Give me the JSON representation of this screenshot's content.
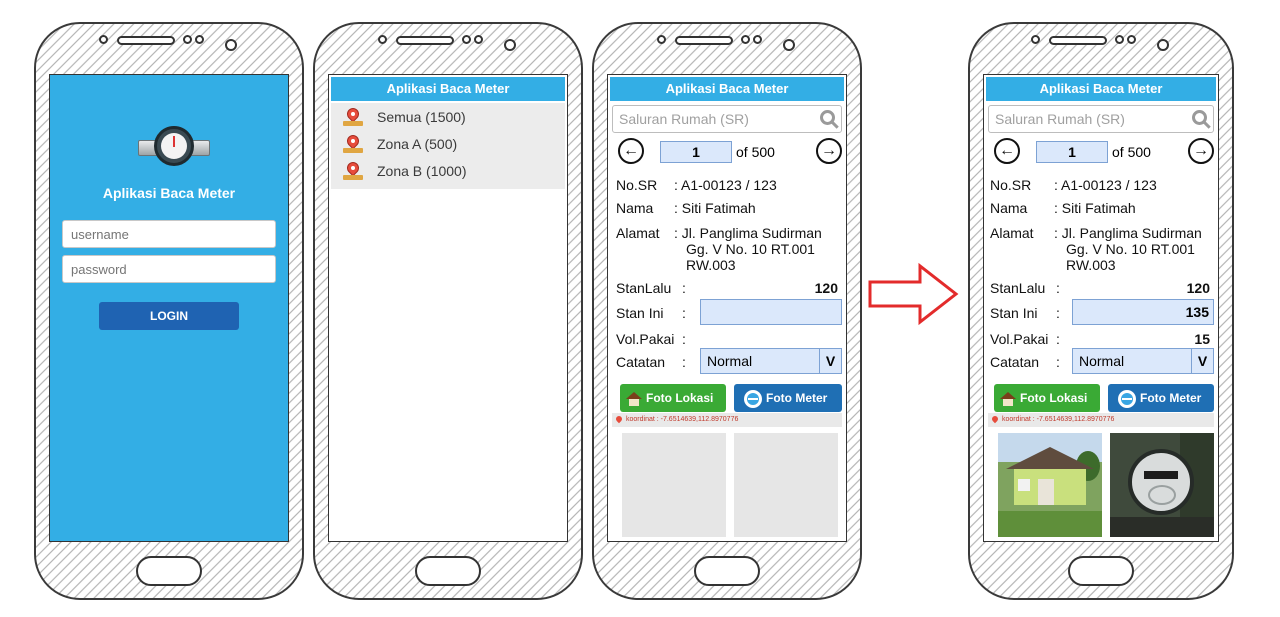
{
  "app_title": "Aplikasi Baca Meter",
  "login": {
    "username_placeholder": "username",
    "password_placeholder": "password",
    "login_label": "LOGIN"
  },
  "zones": [
    {
      "label": "Semua (1500)"
    },
    {
      "label": "Zona A (500)"
    },
    {
      "label": "Zona B (1000)"
    }
  ],
  "detail": {
    "search_placeholder": "Saluran Rumah (SR)",
    "page_current": "1",
    "page_total": "of 500",
    "prev_icon": "←",
    "next_icon": "→",
    "label_nosr": "No.SR",
    "label_nama": "Nama",
    "label_alamat": "Alamat",
    "label_stanlalu": "StanLalu",
    "label_stanini": "Stan Ini",
    "label_volpakai": "Vol.Pakai",
    "label_catatan": "Catatan",
    "colon": ":",
    "nosr": ": A1-00123 / 123",
    "nama": ": Siti Fatimah",
    "alamat_1": ": Jl. Panglima Sudirman",
    "alamat_2": "Gg. V No. 10 RT.001",
    "alamat_3": "RW.003",
    "stanlalu": "120",
    "catatan": "Normal",
    "catatan_arrow": "V",
    "foto_lokasi": "Foto Lokasi",
    "foto_meter": "Foto Meter",
    "koordinat": "koordinat : -7.6514639,112.8970776"
  },
  "filled": {
    "stan_ini": "135",
    "vol_pakai": "15"
  },
  "colors": {
    "accent": "#33aee5",
    "login_button": "#1f63b2",
    "field_fill": "#dbe8fb",
    "foto_lokasi_button": "#3aaa35",
    "foto_meter_button": "#1f6fb4",
    "arrow": "#e32b2b"
  }
}
